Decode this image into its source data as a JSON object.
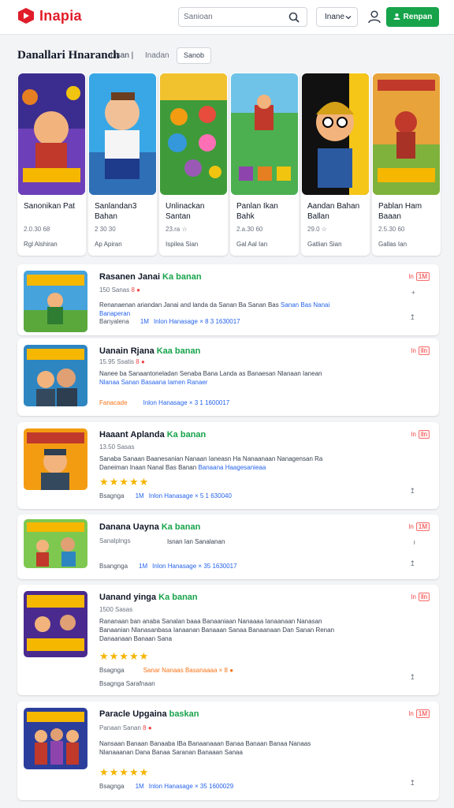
{
  "header": {
    "logo_text": "Inapia",
    "search_placeholder": "Sanioan",
    "lang_label": "Inane",
    "register_label": "Renpan",
    "colors": {
      "brand": "#e11d2a",
      "accent": "#16a34a"
    }
  },
  "featured": {
    "title": "Danallari Hnaranch",
    "sub1": "Lisan |",
    "sub2": "Inadan",
    "button": "Sanob",
    "cards": [
      {
        "title": "Sanonikan Pat",
        "stat": "2.0.30 68",
        "link": "Rgl Alshiran"
      },
      {
        "title": "Sanlandan3 Bahan",
        "stat": "2 30 30",
        "link": "Ap Apiran"
      },
      {
        "title": "Unlinackan Santan",
        "stat": "23.ra ☆",
        "link": "Ispilea Sian"
      },
      {
        "title": "Panlan Ikan Bahk",
        "stat": "2.a.30 60",
        "link": "Gal Aal Ian"
      },
      {
        "title": "Aandan Bahan Ballan",
        "stat": "29.0 ☆",
        "link": "Gatlian Sian"
      },
      {
        "title": "Pablan Ham Baaan",
        "stat": "2.5.30 60",
        "link": "Gallas Ian"
      }
    ]
  },
  "list": [
    {
      "title": "Rasanen Janai",
      "tag": "Ka banan",
      "meta": "150 Sanas",
      "fire": "8 ●",
      "desc": "Renanaenan ariandan Janai and landa da Sanan Ba Sanan Bas",
      "desc_link": "Sanan Bas Nanai Banaperan",
      "foot": "Banyalena",
      "foot_b": "1M",
      "foot_g": "Inlon Hanasage × 8 3 1630017",
      "badge": "ln",
      "badge_box": "1M"
    },
    {
      "title": "Uanain Rjana",
      "tag": "Kaa banan",
      "meta": "15.95 Ssatis",
      "fire": "8 ●",
      "desc": "Nanee ba Sanaantoneladan Senaba Bana Landa as Banaesan Nlanaan Ianean",
      "desc_link": "Nlanaa Sanan Basaana Iamen Ranaer",
      "foot": "Fanacade",
      "foot_b": "",
      "foot_g": "Inlon Hanasage × 3 1 1600017",
      "badge": "ln",
      "badge_box": "lln"
    },
    {
      "title": "Haaant Aplanda",
      "tag": "Ka banan",
      "meta": "13.50 Sasas",
      "fire": "",
      "desc": "Sanaba Sanaan Baanesanian Nanaan Ianeasn Ha Nanaanaan Nanagensan Ra Daneiman Inaan Nanal Bas Banan",
      "desc_link": "Banaana Haagesanieaa",
      "stars": "★★★★★",
      "foot": "Bsagnga",
      "foot_b": "1M",
      "foot_g": "Inlon Hanasage × 5 1 630040",
      "badge": "ln",
      "badge_box": "lln"
    },
    {
      "title": "Danana Uayna",
      "tag": "Ka banan",
      "meta": "Sanalplngs",
      "fire": "",
      "desc": "Isnan Ian Sanalanan",
      "desc_link": "",
      "foot": "Bsangnga",
      "foot_b": "1M",
      "foot_g": "Inlon Hanasage × 35 1630017",
      "badge": "ln",
      "badge_box": "1M"
    },
    {
      "title": "Uanand yinga",
      "tag": "Ka banan",
      "meta": "1500 Sasas",
      "fire": "",
      "desc": "Rananaan ban anaba Sanalan baaa Banaaniaan Nanaaaa Ianaanaan Nanasan Banaanian Nlanasanbasa Ianaanan Banaaan Sanaa Banaanaan Dan Sanan Renan Danaanaan Banaan Sana",
      "desc_link": "",
      "stars": "★★★★★",
      "foot": "Bsagnga",
      "foot_b": "",
      "foot_g": "Sanar Nanaas Basanaaaa × 8 ●",
      "foot2": "Bsagnga    Sarafnaan",
      "badge": "ln",
      "badge_box": "lln"
    },
    {
      "title": "Paracle Upgaina",
      "tag": "baskan",
      "meta": "Panaan Sanan",
      "fire": "8 ●",
      "desc": "Nansaan Banaan Banaaba IBa Banaanaaan Banaa Banaan Banaa Nanaas Nlanaaanan Dana Banaa Saranan Banaaan Sanaa",
      "desc_link": "",
      "stars": "★★★★★",
      "foot": "Bsagnga",
      "foot_b": "1M",
      "foot_g": "Inlon Hanasage × 35 1600029",
      "badge": "ln",
      "badge_box": "1M"
    }
  ]
}
